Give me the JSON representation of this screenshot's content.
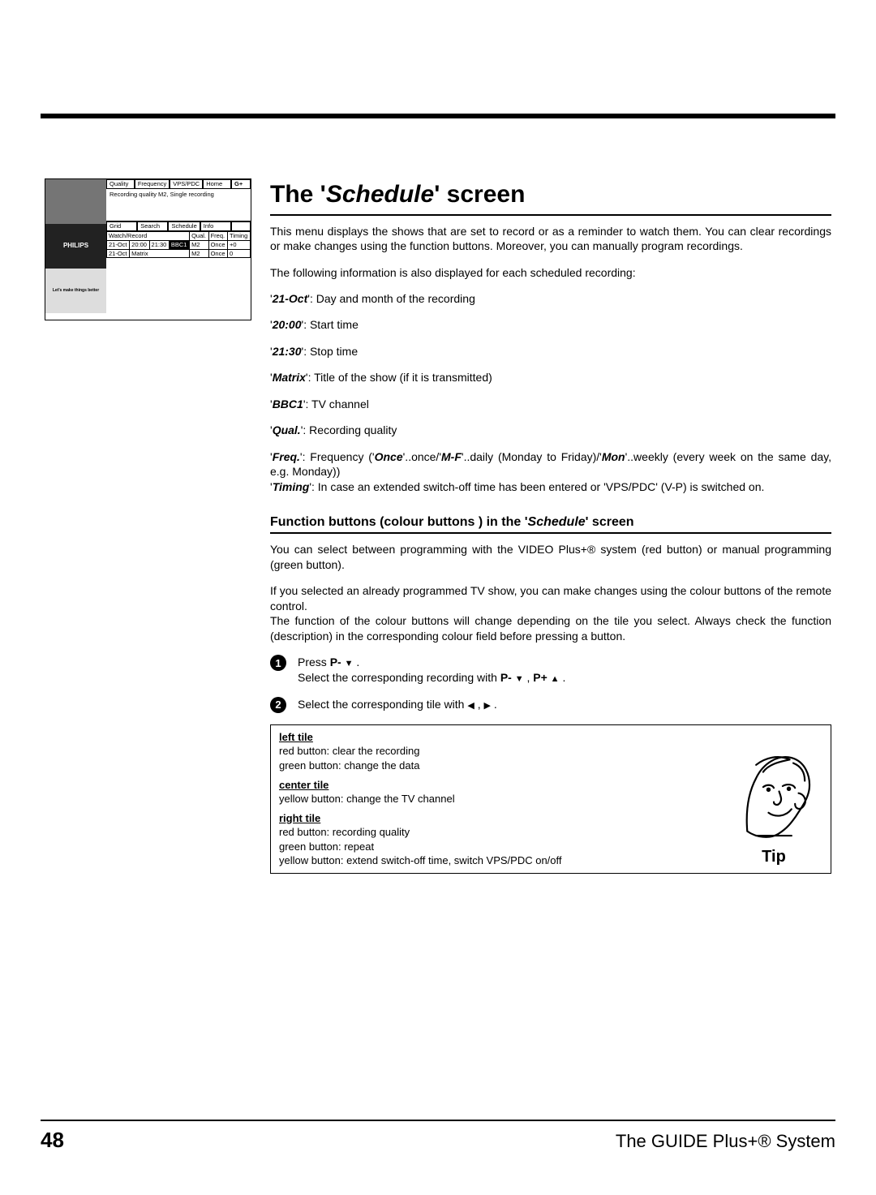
{
  "screen_mock": {
    "top_tabs": [
      "Quality",
      "Frequency",
      "VPS/PDC",
      "Home"
    ],
    "ads_logo": "PHILIPS",
    "ads_text": "Let's make things better",
    "message": "Recording quality M2, Single recording",
    "mid_tabs": [
      "Grid",
      "Search",
      "Schedule",
      "Info"
    ],
    "row_label": "Watch/Record",
    "small_headers": [
      "Qual.",
      "Freq.",
      "Timing"
    ],
    "rows": [
      [
        "21-Oct",
        "20:00",
        "21:30",
        "BBC1",
        "M2",
        "Once",
        "+0"
      ],
      [
        "21-Oct",
        "Matrix",
        "",
        "",
        "M2",
        "Once",
        "0"
      ]
    ]
  },
  "title_prefix": "The '",
  "title_italic": "Schedule",
  "title_suffix": "' screen",
  "intro": "This menu displays the shows that are set to record or as a reminder to watch them. You can clear recordings or make changes using the function buttons. Moreover, you can manually program recordings.",
  "info_lead": "The following information is also displayed for each scheduled recording:",
  "defs": [
    {
      "key": "21-Oct",
      "text": ": Day and month of the recording"
    },
    {
      "key": "20:00",
      "text": ": Start time"
    },
    {
      "key": "21:30",
      "text": ": Stop time"
    },
    {
      "key": "Matrix",
      "text": ": Title of the show (if it is transmitted)"
    },
    {
      "key": "BBC1",
      "text": ": TV channel"
    },
    {
      "key": "Qual.",
      "text": ": Recording quality"
    }
  ],
  "freq_key": "Freq.",
  "freq_pre": ": Frequency ('",
  "freq_once": "Once",
  "freq_mid1": "'..once/'",
  "freq_mf": "M-F",
  "freq_mid2": "'..daily (Monday to Friday)/'",
  "freq_mon": "Mon",
  "freq_post": "'..weekly (every week on the same day, e.g. Monday))",
  "timing_key": "Timing",
  "timing_text": ": In case an extended switch-off time has been entered or 'VPS/PDC' (V-P) is switched on.",
  "subsection_pre": "Function buttons (colour buttons ) in the '",
  "subsection_italic": "Schedule",
  "subsection_post": "' screen",
  "para2": "You can select between programming with the VIDEO Plus+® system (red button) or manual programming (green button).",
  "para3": "If you selected an already programmed TV show, you can make changes using the colour buttons of the remote control.",
  "para4": "The function of the colour buttons will change depending on the tile you select. Always check the function (description) in the corresponding colour field before pressing a button.",
  "step1_a": "Press ",
  "step1_b": "P-",
  "step1_c": " .",
  "step1_d": "Select the corresponding recording with ",
  "step1_e": "P-",
  "step1_f": " , ",
  "step1_g": "P+",
  "step1_h": " .",
  "step2_a": "Select the corresponding tile with ",
  "step2_b": " , ",
  "step2_c": " .",
  "tip": {
    "h1": "left tile",
    "l1a": "red button: clear the recording",
    "l1b": "green button: change the data",
    "h2": "center tile",
    "l2a": "yellow button: change the TV channel",
    "h3": "right tile",
    "l3a": "red button: recording quality",
    "l3b": "green button: repeat",
    "l3c": "yellow button: extend switch-off time, switch VPS/PDC on/off",
    "label": "Tip"
  },
  "footer": {
    "page": "48",
    "system": "The GUIDE Plus+® System"
  }
}
